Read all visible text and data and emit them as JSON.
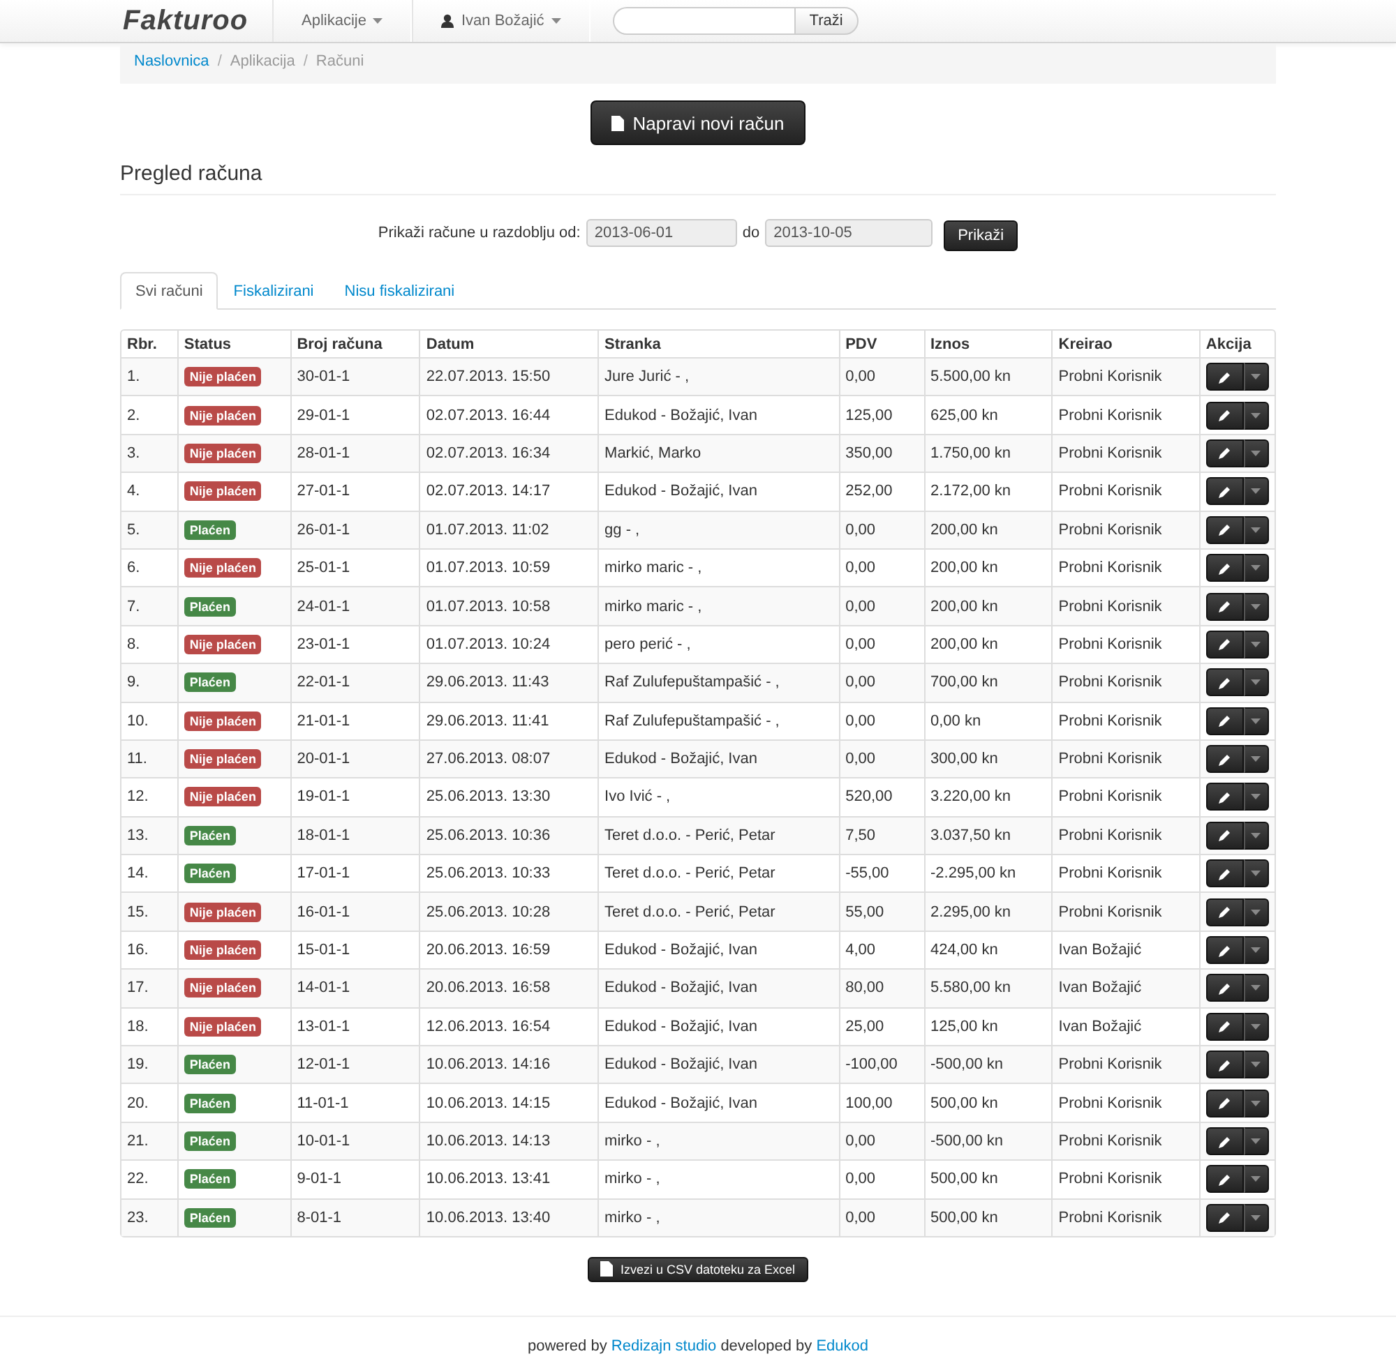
{
  "navbar": {
    "brand": "Fakturoo",
    "menus": [
      {
        "label": "Aplikacije",
        "icon": false
      },
      {
        "label": "Ivan Božajić",
        "icon": true
      }
    ],
    "search": {
      "button": "Traži"
    }
  },
  "breadcrumb": [
    {
      "label": "Naslovnica",
      "link": true
    },
    {
      "separator": "/",
      "label": "Aplikacija",
      "link": false
    },
    {
      "separator": "/",
      "label": "Računi",
      "link": false
    }
  ],
  "new_button": "Napravi novi račun",
  "title": "Pregled računa",
  "filter": {
    "label": "Prikaži račune u razdoblju od:",
    "from": "2013-06-01",
    "to_label": "do",
    "to": "2013-10-05",
    "button": "Prikaži"
  },
  "tabs": [
    {
      "label": "Svi računi",
      "selected": true
    },
    {
      "label": "Fiskalizirani",
      "selected": false
    },
    {
      "label": "Nisu fiskalizirani",
      "selected": false
    }
  ],
  "table": {
    "columns": [
      "Rbr.",
      "Status",
      "Broj računa",
      "Datum",
      "Stranka",
      "PDV",
      "Iznos",
      "Kreirao",
      "Akcija"
    ],
    "rows": [
      {
        "no": "1.",
        "status": "Nije plaćen",
        "paid": false,
        "number": "30-01-1",
        "date": "22.07.2013. 15:50",
        "client": "Jure Jurić - ,",
        "vat": "0,00",
        "amount": "5.500,00 kn",
        "created_by": "Probni Korisnik"
      },
      {
        "no": "2.",
        "status": "Nije plaćen",
        "paid": false,
        "number": "29-01-1",
        "date": "02.07.2013. 16:44",
        "client": "Edukod - Božajić, Ivan",
        "vat": "125,00",
        "amount": "625,00 kn",
        "created_by": "Probni Korisnik"
      },
      {
        "no": "3.",
        "status": "Nije plaćen",
        "paid": false,
        "number": "28-01-1",
        "date": "02.07.2013. 16:34",
        "client": "Markić, Marko",
        "vat": "350,00",
        "amount": "1.750,00 kn",
        "created_by": "Probni Korisnik"
      },
      {
        "no": "4.",
        "status": "Nije plaćen",
        "paid": false,
        "number": "27-01-1",
        "date": "02.07.2013. 14:17",
        "client": "Edukod - Božajić, Ivan",
        "vat": "252,00",
        "amount": "2.172,00 kn",
        "created_by": "Probni Korisnik"
      },
      {
        "no": "5.",
        "status": "Plaćen",
        "paid": true,
        "number": "26-01-1",
        "date": "01.07.2013. 11:02",
        "client": "gg - ,",
        "vat": "0,00",
        "amount": "200,00 kn",
        "created_by": "Probni Korisnik"
      },
      {
        "no": "6.",
        "status": "Nije plaćen",
        "paid": false,
        "number": "25-01-1",
        "date": "01.07.2013. 10:59",
        "client": "mirko maric - ,",
        "vat": "0,00",
        "amount": "200,00 kn",
        "created_by": "Probni Korisnik"
      },
      {
        "no": "7.",
        "status": "Plaćen",
        "paid": true,
        "number": "24-01-1",
        "date": "01.07.2013. 10:58",
        "client": "mirko maric - ,",
        "vat": "0,00",
        "amount": "200,00 kn",
        "created_by": "Probni Korisnik"
      },
      {
        "no": "8.",
        "status": "Nije plaćen",
        "paid": false,
        "number": "23-01-1",
        "date": "01.07.2013. 10:24",
        "client": "pero perić - ,",
        "vat": "0,00",
        "amount": "200,00 kn",
        "created_by": "Probni Korisnik"
      },
      {
        "no": "9.",
        "status": "Plaćen",
        "paid": true,
        "number": "22-01-1",
        "date": "29.06.2013. 11:43",
        "client": "Raf Zulufepuštampašić - ,",
        "vat": "0,00",
        "amount": "700,00 kn",
        "created_by": "Probni Korisnik"
      },
      {
        "no": "10.",
        "status": "Nije plaćen",
        "paid": false,
        "number": "21-01-1",
        "date": "29.06.2013. 11:41",
        "client": "Raf Zulufepuštampašić - ,",
        "vat": "0,00",
        "amount": "0,00 kn",
        "created_by": "Probni Korisnik"
      },
      {
        "no": "11.",
        "status": "Nije plaćen",
        "paid": false,
        "number": "20-01-1",
        "date": "27.06.2013. 08:07",
        "client": "Edukod - Božajić, Ivan",
        "vat": "0,00",
        "amount": "300,00 kn",
        "created_by": "Probni Korisnik"
      },
      {
        "no": "12.",
        "status": "Nije plaćen",
        "paid": false,
        "number": "19-01-1",
        "date": "25.06.2013. 13:30",
        "client": "Ivo Ivić - ,",
        "vat": "520,00",
        "amount": "3.220,00 kn",
        "created_by": "Probni Korisnik"
      },
      {
        "no": "13.",
        "status": "Plaćen",
        "paid": true,
        "number": "18-01-1",
        "date": "25.06.2013. 10:36",
        "client": "Teret d.o.o. - Perić, Petar",
        "vat": "7,50",
        "amount": "3.037,50 kn",
        "created_by": "Probni Korisnik"
      },
      {
        "no": "14.",
        "status": "Plaćen",
        "paid": true,
        "number": "17-01-1",
        "date": "25.06.2013. 10:33",
        "client": "Teret d.o.o. - Perić, Petar",
        "vat": "-55,00",
        "amount": "-2.295,00 kn",
        "created_by": "Probni Korisnik"
      },
      {
        "no": "15.",
        "status": "Nije plaćen",
        "paid": false,
        "number": "16-01-1",
        "date": "25.06.2013. 10:28",
        "client": "Teret d.o.o. - Perić, Petar",
        "vat": "55,00",
        "amount": "2.295,00 kn",
        "created_by": "Probni Korisnik"
      },
      {
        "no": "16.",
        "status": "Nije plaćen",
        "paid": false,
        "number": "15-01-1",
        "date": "20.06.2013. 16:59",
        "client": "Edukod - Božajić, Ivan",
        "vat": "4,00",
        "amount": "424,00 kn",
        "created_by": "Ivan Božajić"
      },
      {
        "no": "17.",
        "status": "Nije plaćen",
        "paid": false,
        "number": "14-01-1",
        "date": "20.06.2013. 16:58",
        "client": "Edukod - Božajić, Ivan",
        "vat": "80,00",
        "amount": "5.580,00 kn",
        "created_by": "Ivan Božajić"
      },
      {
        "no": "18.",
        "status": "Nije plaćen",
        "paid": false,
        "number": "13-01-1",
        "date": "12.06.2013. 16:54",
        "client": "Edukod - Božajić, Ivan",
        "vat": "25,00",
        "amount": "125,00 kn",
        "created_by": "Ivan Božajić"
      },
      {
        "no": "19.",
        "status": "Plaćen",
        "paid": true,
        "number": "12-01-1",
        "date": "10.06.2013. 14:16",
        "client": "Edukod - Božajić, Ivan",
        "vat": "-100,00",
        "amount": "-500,00 kn",
        "created_by": "Probni Korisnik"
      },
      {
        "no": "20.",
        "status": "Plaćen",
        "paid": true,
        "number": "11-01-1",
        "date": "10.06.2013. 14:15",
        "client": "Edukod - Božajić, Ivan",
        "vat": "100,00",
        "amount": "500,00 kn",
        "created_by": "Probni Korisnik"
      },
      {
        "no": "21.",
        "status": "Plaćen",
        "paid": true,
        "number": "10-01-1",
        "date": "10.06.2013. 14:13",
        "client": "mirko - ,",
        "vat": "0,00",
        "amount": "-500,00 kn",
        "created_by": "Probni Korisnik"
      },
      {
        "no": "22.",
        "status": "Plaćen",
        "paid": true,
        "number": "9-01-1",
        "date": "10.06.2013. 13:41",
        "client": "mirko - ,",
        "vat": "0,00",
        "amount": "500,00 kn",
        "created_by": "Probni Korisnik"
      },
      {
        "no": "23.",
        "status": "Plaćen",
        "paid": true,
        "number": "8-01-1",
        "date": "10.06.2013. 13:40",
        "client": "mirko - ,",
        "vat": "0,00",
        "amount": "500,00 kn",
        "created_by": "Probni Korisnik"
      }
    ]
  },
  "export_button": "Izvezi u CSV datoteku za Excel",
  "footer": {
    "prefix": "powered by",
    "link1": "Redizajn studio",
    "middle": "developed by",
    "link2": "Edukod"
  }
}
